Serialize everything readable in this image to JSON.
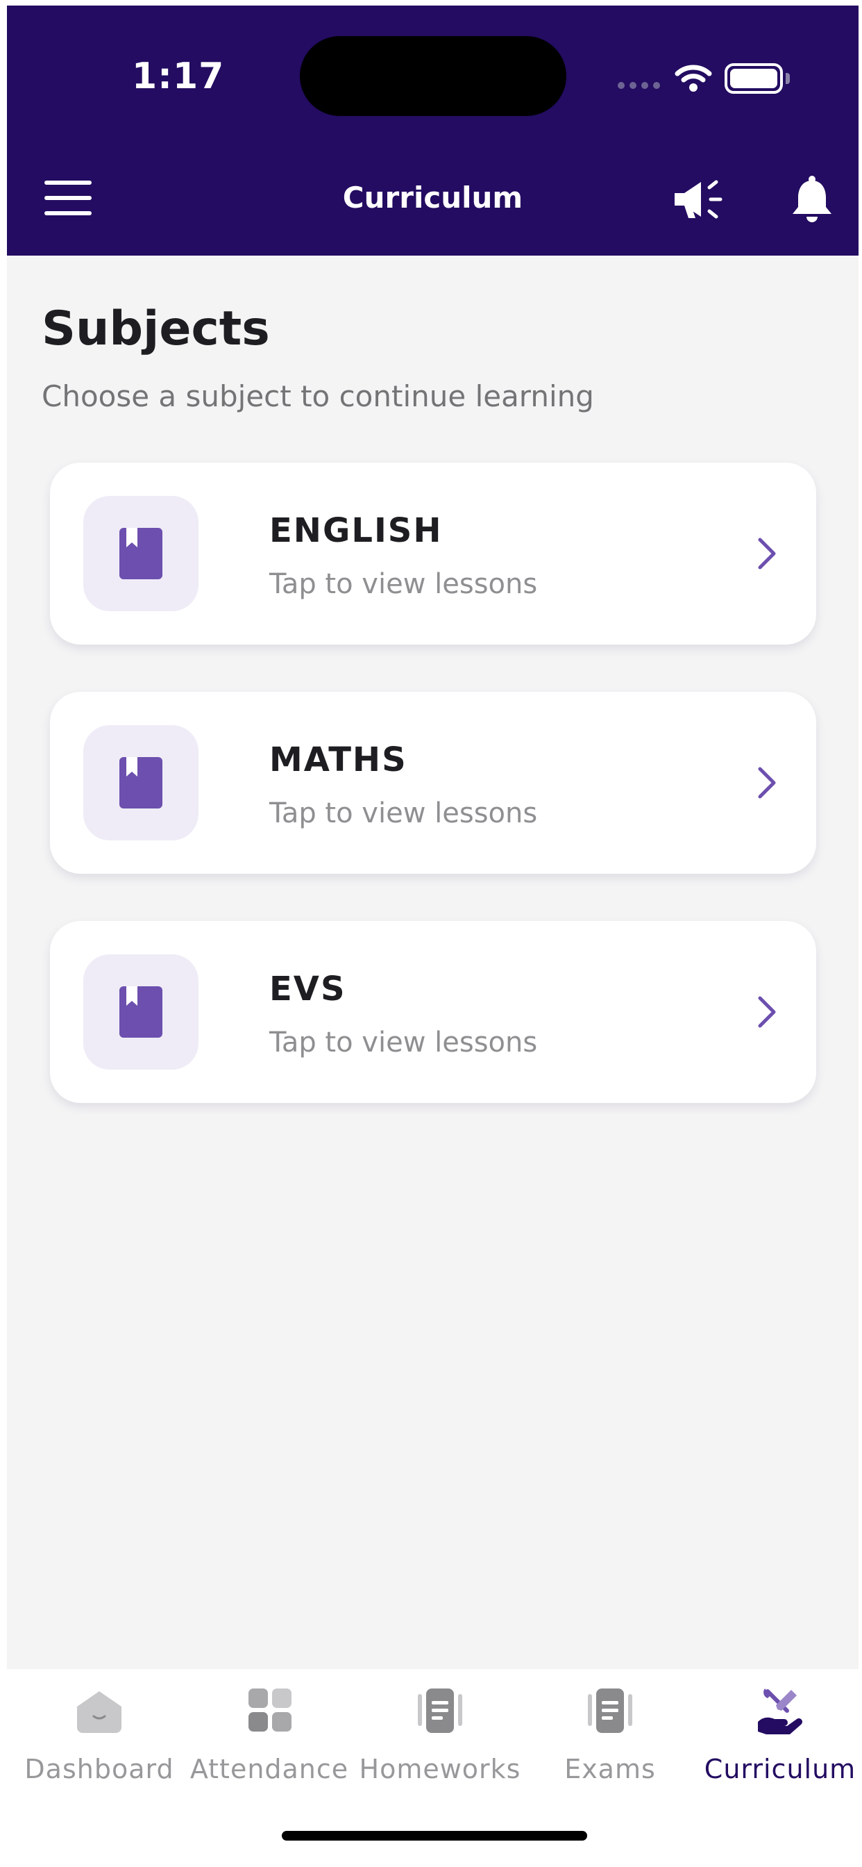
{
  "status_bar": {
    "time": "1:17"
  },
  "header": {
    "title": "Curriculum"
  },
  "section": {
    "title": "Subjects",
    "subtitle": "Choose a subject to continue learning"
  },
  "subjects": [
    {
      "name": "ENGLISH",
      "hint": "Tap to view lessons",
      "icon": "book-icon"
    },
    {
      "name": "MATHS",
      "hint": "Tap to view lessons",
      "icon": "book-icon"
    },
    {
      "name": "EVS",
      "hint": "Tap to view lessons",
      "icon": "book-icon"
    }
  ],
  "tabs": [
    {
      "label": "Dashboard",
      "icon": "home-icon",
      "active": false
    },
    {
      "label": "Attendance",
      "icon": "grid-icon",
      "active": false
    },
    {
      "label": "Homeworks",
      "icon": "document-icon",
      "active": false
    },
    {
      "label": "Exams",
      "icon": "document-icon",
      "active": false
    },
    {
      "label": "Curriculum",
      "icon": "tools-hand-icon",
      "active": true
    }
  ],
  "colors": {
    "header_bg": "#230c61",
    "accent": "#6c4fae",
    "icon_bg": "#efecf7",
    "page_bg": "#f4f4f5"
  }
}
